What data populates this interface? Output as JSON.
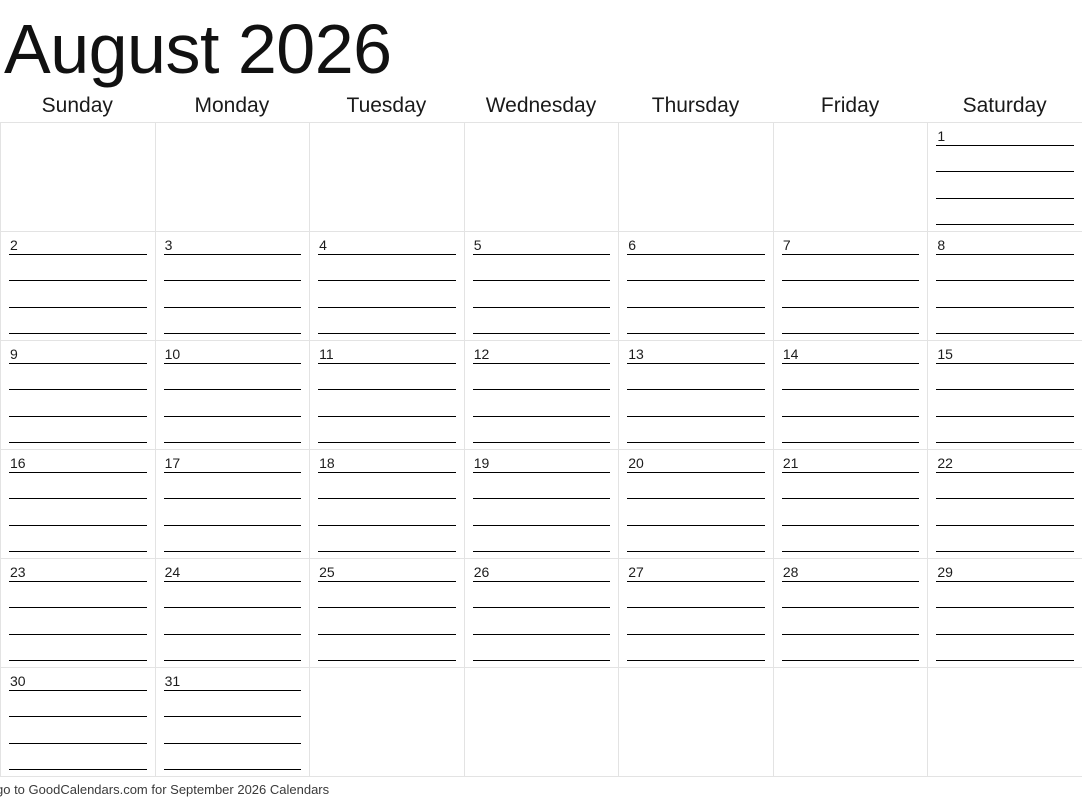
{
  "title": "August 2026",
  "weekdays": [
    "Sunday",
    "Monday",
    "Tuesday",
    "Wednesday",
    "Thursday",
    "Friday",
    "Saturday"
  ],
  "footer": "go to GoodCalendars.com for September 2026 Calendars",
  "colors": {
    "grid_line": "#e3e3e3",
    "writing_line": "#000000",
    "text": "#111111",
    "footer_text": "#3a3a3a",
    "background": "#ffffff"
  },
  "lines_per_day": 4,
  "weeks": [
    {
      "days": [
        {
          "date": ""
        },
        {
          "date": ""
        },
        {
          "date": ""
        },
        {
          "date": ""
        },
        {
          "date": ""
        },
        {
          "date": ""
        },
        {
          "date": "1"
        }
      ]
    },
    {
      "days": [
        {
          "date": "2"
        },
        {
          "date": "3"
        },
        {
          "date": "4"
        },
        {
          "date": "5"
        },
        {
          "date": "6"
        },
        {
          "date": "7"
        },
        {
          "date": "8"
        }
      ]
    },
    {
      "days": [
        {
          "date": "9"
        },
        {
          "date": "10"
        },
        {
          "date": "11"
        },
        {
          "date": "12"
        },
        {
          "date": "13"
        },
        {
          "date": "14"
        },
        {
          "date": "15"
        }
      ]
    },
    {
      "days": [
        {
          "date": "16"
        },
        {
          "date": "17"
        },
        {
          "date": "18"
        },
        {
          "date": "19"
        },
        {
          "date": "20"
        },
        {
          "date": "21"
        },
        {
          "date": "22"
        }
      ]
    },
    {
      "days": [
        {
          "date": "23"
        },
        {
          "date": "24"
        },
        {
          "date": "25"
        },
        {
          "date": "26"
        },
        {
          "date": "27"
        },
        {
          "date": "28"
        },
        {
          "date": "29"
        }
      ]
    },
    {
      "days": [
        {
          "date": "30"
        },
        {
          "date": "31"
        },
        {
          "date": ""
        },
        {
          "date": ""
        },
        {
          "date": ""
        },
        {
          "date": ""
        },
        {
          "date": ""
        }
      ]
    }
  ]
}
